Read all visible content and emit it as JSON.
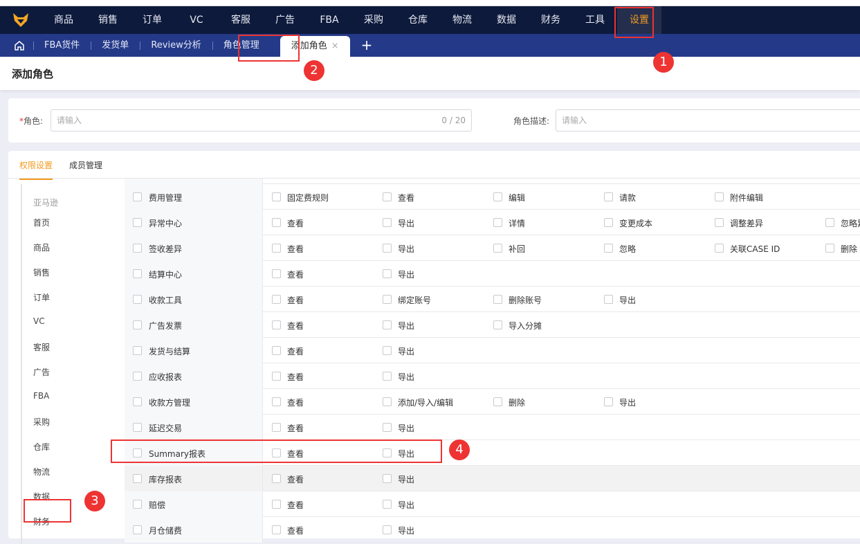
{
  "nav": {
    "items": [
      "商品",
      "销售",
      "订单",
      "VC",
      "客服",
      "广告",
      "FBA",
      "采购",
      "仓库",
      "物流",
      "数据",
      "财务",
      "工具",
      "设置"
    ],
    "active": "设置"
  },
  "tabs": {
    "items": [
      "FBA货件",
      "发货单",
      "Review分析",
      "角色管理"
    ],
    "active": "添加角色",
    "close": "×",
    "add": "+"
  },
  "page": {
    "title": "添加角色"
  },
  "form": {
    "role_label": "角色:",
    "required_mark": "*",
    "role_placeholder": "请输入",
    "role_count": "0 / 20",
    "desc_label": "角色描述:",
    "desc_placeholder": "请输入"
  },
  "card_tabs": [
    "权限设置",
    "成员管理"
  ],
  "sidebar": {
    "group": "亚马逊",
    "items": [
      "首页",
      "商品",
      "销售",
      "订单",
      "VC",
      "客服",
      "广告",
      "FBA",
      "采购",
      "仓库",
      "物流",
      "数据",
      "财务"
    ]
  },
  "permissions": [
    {
      "name": "费用管理",
      "actions": [
        "固定费规则",
        "查看",
        "编辑",
        "请款",
        "附件编辑"
      ]
    },
    {
      "name": "异常中心",
      "actions": [
        "查看",
        "导出",
        "详情",
        "变更成本",
        "调整差异",
        "忽略异常"
      ]
    },
    {
      "name": "签收差异",
      "actions": [
        "查看",
        "导出",
        "补回",
        "忽略",
        "关联CASE ID",
        "删除"
      ]
    },
    {
      "name": "结算中心",
      "actions": [
        "查看",
        "导出"
      ]
    },
    {
      "name": "收款工具",
      "actions": [
        "查看",
        "绑定账号",
        "删除账号",
        "导出"
      ]
    },
    {
      "name": "广告发票",
      "actions": [
        "查看",
        "导出",
        "导入分摊"
      ]
    },
    {
      "name": "发货与结算",
      "actions": [
        "查看",
        "导出"
      ]
    },
    {
      "name": "应收报表",
      "actions": [
        "查看",
        "导出"
      ]
    },
    {
      "name": "收款方管理",
      "actions": [
        "查看",
        "添加/导入/编辑",
        "删除",
        "导出"
      ]
    },
    {
      "name": "延迟交易",
      "actions": [
        "查看",
        "导出"
      ]
    },
    {
      "name": "Summary报表",
      "actions": [
        "查看",
        "导出"
      ]
    },
    {
      "name": "库存报表",
      "actions": [
        "查看",
        "导出"
      ]
    },
    {
      "name": "赔偿",
      "actions": [
        "查看",
        "导出"
      ]
    },
    {
      "name": "月仓储费",
      "actions": [
        "查看",
        "导出"
      ]
    }
  ],
  "annotations": [
    "1",
    "2",
    "3",
    "4"
  ],
  "colors": {
    "nav": "#0d1a3c",
    "tabs": "#243a88",
    "accent": "#f39a1e",
    "annotation": "#ee3333"
  }
}
